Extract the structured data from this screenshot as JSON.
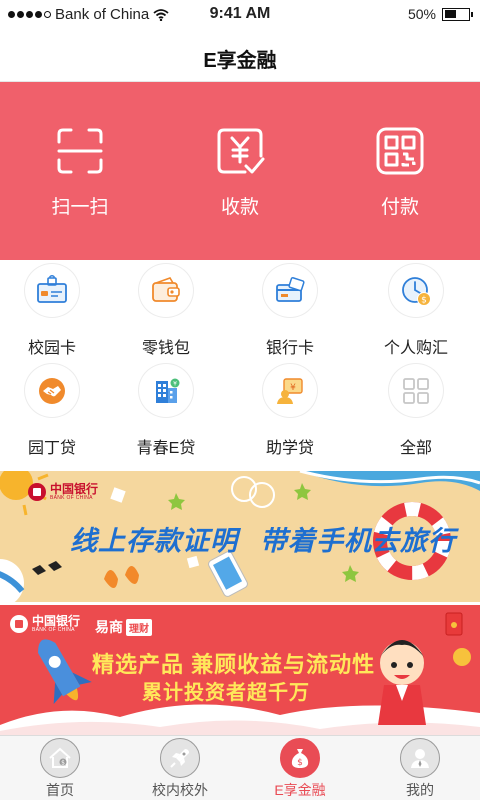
{
  "status_bar": {
    "carrier": "Bank of China",
    "time": "9:41 AM",
    "battery_percent": "50%",
    "battery_level": 0.5
  },
  "nav": {
    "title": "E享金融"
  },
  "actions": [
    {
      "label": "扫一扫",
      "icon": "scan-icon"
    },
    {
      "label": "收款",
      "icon": "receive-money-icon"
    },
    {
      "label": "付款",
      "icon": "payment-code-icon"
    }
  ],
  "services": [
    {
      "label": "校园卡",
      "icon": "campus-card-icon"
    },
    {
      "label": "零钱包",
      "icon": "wallet-icon"
    },
    {
      "label": "银行卡",
      "icon": "bank-card-icon"
    },
    {
      "label": "个人购汇",
      "icon": "currency-exchange-icon"
    },
    {
      "label": "园丁贷",
      "icon": "handshake-icon"
    },
    {
      "label": "青春E贷",
      "icon": "building-icon"
    },
    {
      "label": "助学贷",
      "icon": "student-loan-icon"
    },
    {
      "label": "全部",
      "icon": "grid-icon"
    }
  ],
  "banners": {
    "travel": {
      "logo_cn": "中国银行",
      "logo_en": "BANK OF CHINA",
      "text_part1": "线上存款证明",
      "text_part2": "带着手机去旅行"
    },
    "finance": {
      "logo_cn": "中国银行",
      "logo_en": "BANK OF CHINA",
      "partner": "易商",
      "partner_tag": "理财",
      "line1": "精选产品 兼顾收益与流动性",
      "line2": "累计投资者超千万"
    }
  },
  "tabs": [
    {
      "label": "首页",
      "icon": "home-icon",
      "active": false
    },
    {
      "label": "校内校外",
      "icon": "rocket-icon",
      "active": false
    },
    {
      "label": "E享金融",
      "icon": "money-bag-icon",
      "active": true
    },
    {
      "label": "我的",
      "icon": "user-icon",
      "active": false
    }
  ],
  "colors": {
    "accent_red": "#f0606b",
    "tab_active": "#e94c55",
    "icon_blue": "#2f7fd9",
    "icon_orange": "#f08a2c"
  }
}
